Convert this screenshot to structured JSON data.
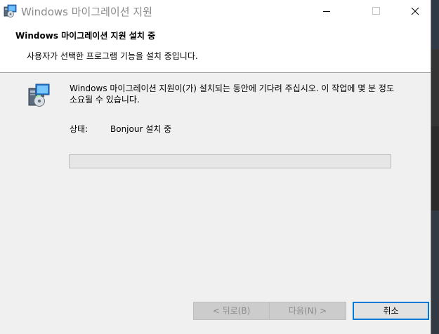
{
  "window": {
    "title": "Windows 마이그레이션 지원",
    "app_icon": "installer-icon",
    "controls": {
      "minimize_icon": "minimize-icon",
      "maximize_icon": "maximize-icon",
      "close_icon": "close-icon"
    }
  },
  "banner": {
    "title": "Windows 마이그레이션 지원 설치 중",
    "subtitle": "사용자가 선택한 프로그램 기능을 설치 중입니다."
  },
  "body": {
    "icon": "setup-icon",
    "message": "Windows 마이그레이션 지원이(가) 설치되는 동안에 기다려 주십시오. 이 작업에 몇 분 정도 소요될 수 있습니다.",
    "status_label": "상태:",
    "status_value": "Bonjour 설치 중",
    "progress_fraction": 0
  },
  "buttons": {
    "back": "< 뒤로(B)",
    "next": "다음(N) >",
    "cancel": "취소"
  },
  "colors": {
    "accent": "#0078d7",
    "window_bg": "#f0f0f0",
    "disabled_text": "#8c8c8c"
  }
}
